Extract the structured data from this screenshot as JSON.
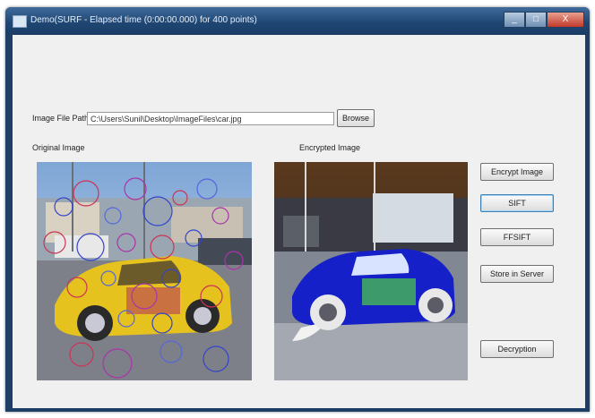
{
  "window": {
    "title": "Demo(SURF - Elapsed time (0:00:00.000) for 400 points)",
    "minimize": "_",
    "maximize": "□",
    "close": "X"
  },
  "form": {
    "path_label": "Image File Path :",
    "path_value": "C:\\Users\\Sunil\\Desktop\\ImageFiles\\car.jpg",
    "browse_label": "Browse",
    "original_label": "Original Image",
    "encrypted_label": "Encrypted Image"
  },
  "buttons": {
    "encrypt": "Encrypt Image",
    "sift": "SIFT",
    "ffsift": "FFSIFT",
    "server": "Store in Server",
    "decrypt": "Decryption"
  },
  "colors": {
    "title_bar": "#1f4673",
    "client_bg": "#f0f0f0",
    "encrypted_car": "#1520c8",
    "original_car": "#e6c21e"
  }
}
